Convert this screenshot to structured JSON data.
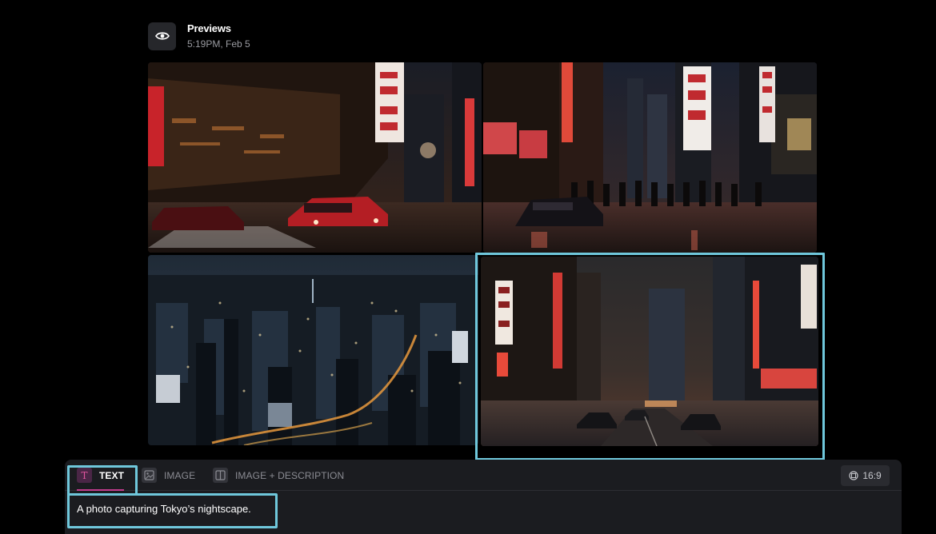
{
  "header": {
    "title": "Previews",
    "timestamp": "5:19PM, Feb 5",
    "icon": "eye-icon"
  },
  "gallery": {
    "images": [
      {
        "subject": "neon-lit Tokyo street at night with red sports car",
        "selected": false
      },
      {
        "subject": "crowded Tokyo street at night with neon signs and black car",
        "selected": false
      },
      {
        "subject": "aerial view of Tokyo city lights at night",
        "selected": true
      },
      {
        "subject": "Tokyo avenue at night with neon signs and traffic",
        "selected": false
      }
    ]
  },
  "prompt_panel": {
    "tabs": [
      {
        "label": "TEXT",
        "icon": "text-t-icon",
        "active": true
      },
      {
        "label": "IMAGE",
        "icon": "image-icon",
        "active": false
      },
      {
        "label": "IMAGE + DESCRIPTION",
        "icon": "image-description-icon",
        "active": false
      }
    ],
    "aspect_ratio": "16:9",
    "prompt_text": "A photo capturing Tokyo’s nightscape."
  },
  "colors": {
    "background": "#000000",
    "panel": "#1b1c20",
    "highlight": "#6fc7db",
    "accent": "#c23c8e"
  }
}
